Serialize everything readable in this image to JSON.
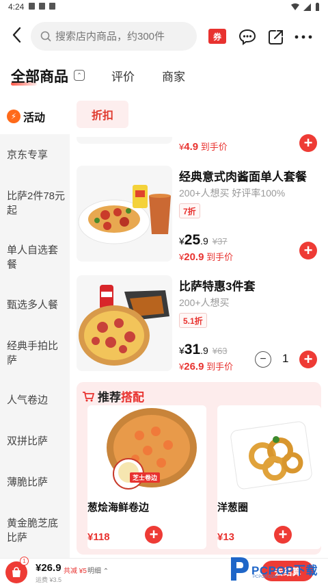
{
  "status": {
    "time": "4:24"
  },
  "search": {
    "placeholder": "搜索店内商品，约300件"
  },
  "header": {
    "coupon_label": "券"
  },
  "tabs": [
    {
      "label": "全部商品",
      "active": true
    },
    {
      "label": "评价",
      "active": false
    },
    {
      "label": "商家",
      "active": false
    }
  ],
  "sidebar": {
    "active_label": "活动",
    "items": [
      "京东专享",
      "比萨2件78元起",
      "单人自选套餐",
      "甄选多人餐",
      "经典手拍比萨",
      "人气卷边",
      "双拼比萨",
      "薄脆比萨",
      "黄金脆芝底比萨"
    ]
  },
  "filter_chip": "折扣",
  "partial_item": {
    "price_symbol": "¥",
    "price": "4.9",
    "label": "到手价"
  },
  "products": [
    {
      "title": "经典意式肉酱面单人套餐",
      "stats": "200+人想买 好评率100%",
      "discount": "7折",
      "price_symbol": "¥",
      "price_int": "25",
      "price_dec": ".9",
      "original": "¥37",
      "deal_symbol": "¥",
      "deal_price": "20.9",
      "deal_label": "到手价"
    },
    {
      "title": "比萨特惠3件套",
      "stats": "200+人想买",
      "discount": "5.1折",
      "price_symbol": "¥",
      "price_int": "31",
      "price_dec": ".9",
      "original": "¥63",
      "deal_symbol": "¥",
      "deal_price": "26.9",
      "deal_label": "到手价",
      "quantity": "1"
    }
  ],
  "recommend": {
    "title_prefix": "推荐",
    "title_highlight": "搭配",
    "badge": "芝士卷边",
    "cards": [
      {
        "name": "葱烩海鲜卷边",
        "price": "¥118"
      },
      {
        "name": "洋葱圈",
        "price": "¥13"
      }
    ]
  },
  "cart": {
    "count": "1",
    "total": "¥26.9",
    "saved": "共减 ¥5",
    "detail": "明细",
    "fee": "运费 ¥3.5",
    "checkout": "去结算"
  },
  "watermark": {
    "text": "PCPOP下载",
    "sub": "PCPOP.COM"
  },
  "colors": {
    "accent": "#ee3b35",
    "chip_bg": "#fdeeee",
    "recommend_bg": "#fdecec"
  }
}
